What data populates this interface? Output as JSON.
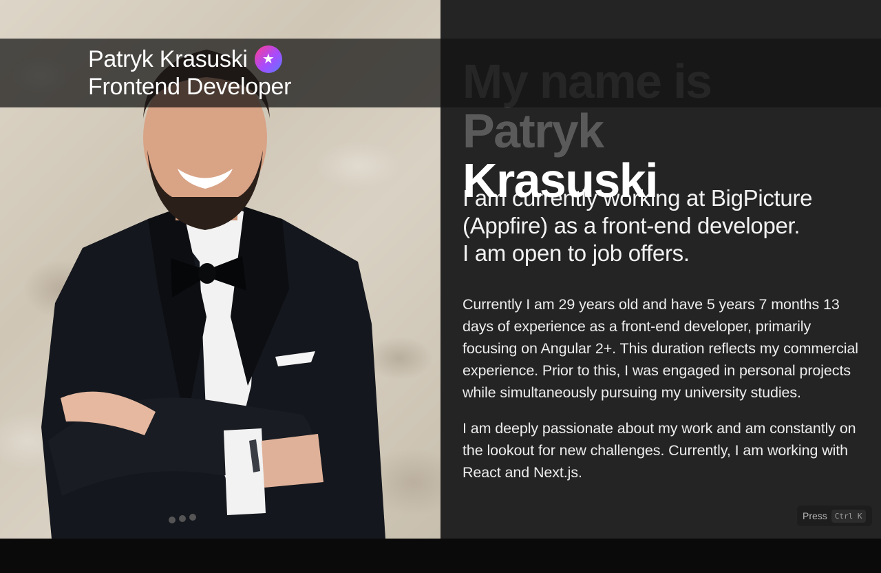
{
  "header": {
    "name": "Patryk Krasuski",
    "role": "Frontend Developer",
    "badge_icon": "sparkle-emoji-icon"
  },
  "hero": {
    "name_line1": "My name is Patryk",
    "name_line2": "Krasuski"
  },
  "lead": {
    "line1": "I am currently working at BigPicture",
    "line2": "(Appfire) as a front-end developer.",
    "line3": "I am open to job offers."
  },
  "bio": {
    "paragraph1": "Currently I am 29 years old and have 5 years 7 months 13 days of experience as a front-end developer, primarily focusing on Angular 2+. This duration reflects my commercial experience. Prior to this, I was engaged in personal projects while simultaneously pursuing my university studies.",
    "paragraph2": "I am deeply passionate about my work and am constantly on the lookout for new challenges. Currently, I am working with React and Next.js."
  },
  "command_hint": {
    "label": "Press",
    "shortcut": "Ctrl K"
  },
  "colors": {
    "content_bg": "#242424",
    "name_dim": "#5a5a5a",
    "badge_gradient_start": "#ff3d8e",
    "badge_gradient_end": "#5c7bff"
  }
}
